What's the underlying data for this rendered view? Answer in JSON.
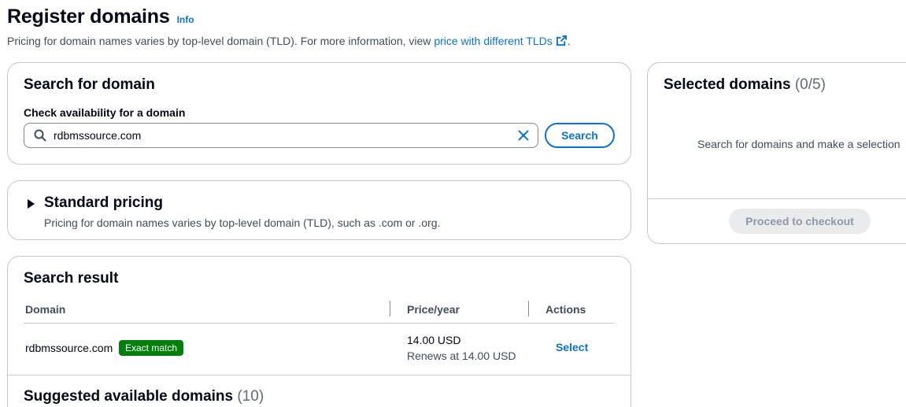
{
  "header": {
    "title": "Register domains",
    "info": "Info",
    "description_prefix": "Pricing for domain names varies by top-level domain (TLD). For more information, view ",
    "description_link": "price with different TLDs",
    "description_suffix": "."
  },
  "search_card": {
    "title": "Search for domain",
    "label": "Check availability for a domain",
    "value": "rdbmssource.com",
    "button": "Search"
  },
  "pricing_card": {
    "title": "Standard pricing",
    "description": "Pricing for domain names varies by top-level domain (TLD), such as .com or .org."
  },
  "result_card": {
    "title": "Search result",
    "columns": [
      "Domain",
      "Price/year",
      "Actions"
    ],
    "row": {
      "domain": "rdbmssource.com",
      "badge": "Exact match",
      "price": "14.00 USD",
      "renews": "Renews at 14.00 USD",
      "action": "Select"
    },
    "suggested_title": "Suggested available domains",
    "suggested_count": "(10)"
  },
  "selected_card": {
    "title": "Selected domains",
    "count": "(0/5)",
    "empty": "Search for domains and make a selection",
    "button": "Proceed to checkout"
  },
  "colors": {
    "link": "#0972d3",
    "success": "#037f0c",
    "border": "#c6c6cd"
  },
  "icons": [
    "search-icon",
    "clear-icon",
    "external-link-icon",
    "caret-right-icon"
  ]
}
